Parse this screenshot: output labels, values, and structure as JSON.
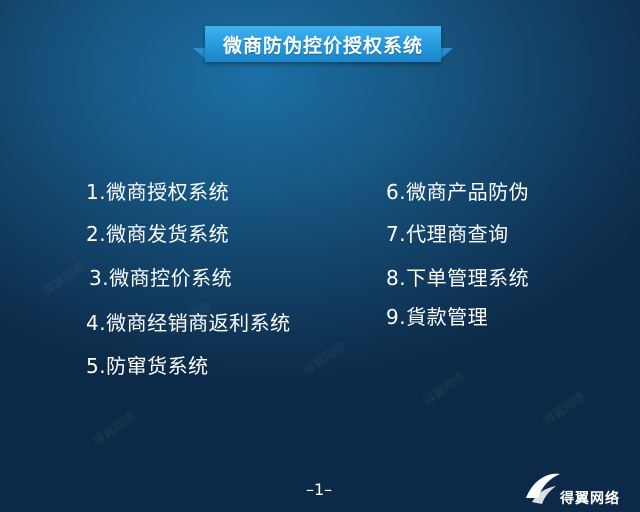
{
  "title": "微商防伪控价授权系统",
  "items_left": [
    "1.微商授权系统",
    "2.微商发货系统",
    "3.微商控价系统",
    "4.微商经销商返利系统",
    "5.防窜货系统"
  ],
  "items_right": [
    "6.微商产品防伪",
    "7.代理商查询",
    "8.下单管理系统",
    "9.貨款管理"
  ],
  "page_number": "–1–",
  "logo": {
    "text": "得翼网络",
    "icon": "wing-logo-icon"
  },
  "watermark_text": "得翼网络",
  "colors": {
    "background_dark": "#0c2a47",
    "background_light": "#1c6fa6",
    "ribbon": "#2698de",
    "text": "#ffffff"
  }
}
